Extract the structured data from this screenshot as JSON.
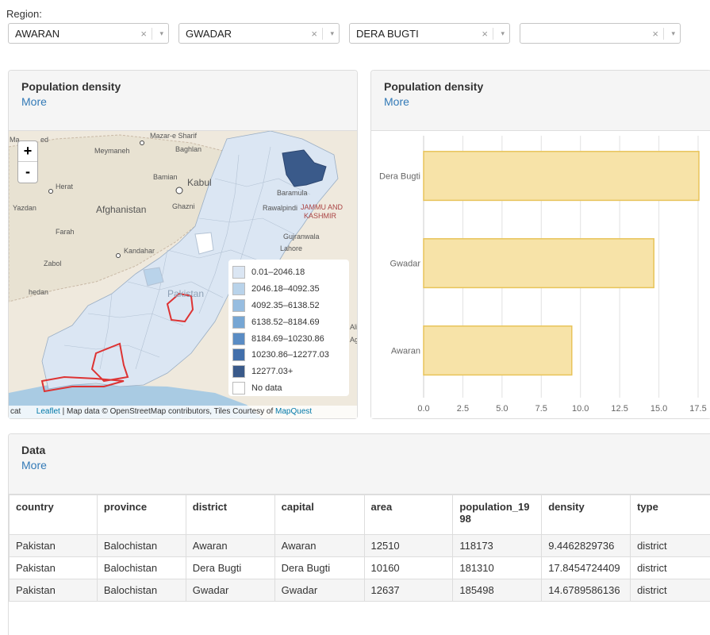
{
  "region_label": "Region:",
  "selects": [
    {
      "value": "AWARAN",
      "clear": "×",
      "arrow": "▾"
    },
    {
      "value": "GWADAR",
      "clear": "×",
      "arrow": "▾"
    },
    {
      "value": "DERA BUGTI",
      "clear": "×",
      "arrow": "▾"
    },
    {
      "value": "",
      "clear": "×",
      "arrow": "▾"
    }
  ],
  "map_panel": {
    "title": "Population density",
    "more": "More"
  },
  "chart_panel": {
    "title": "Population density",
    "more": "More"
  },
  "data_panel": {
    "title": "Data",
    "more": "More"
  },
  "map": {
    "zoom_in": "+",
    "zoom_out": "-",
    "places": {
      "mazar": "Mazar-e Sharif",
      "meymaneh": "Meymaneh",
      "baghlan": "Baghlan",
      "kabul": "Kabul",
      "bamian": "Bamian",
      "herat": "Herat",
      "afghanistan": "Afghanistan",
      "ghazni": "Ghazni",
      "farah": "Farah",
      "kandahar": "Kandahar",
      "zabol": "Zabol",
      "yazdan": "Yazdan",
      "baramula": "Baramula",
      "jammu": "JAMMU AND",
      "kashmir": "KASHMIR",
      "lahore": "Lahore",
      "gujranwala": "Gujranwala",
      "pakistan": "Pakistan",
      "rawalpindi": "Rawalpindi",
      "ma": "Ma",
      "ed": "ed",
      "hedan": "hedan",
      "ali": "Ali",
      "ag": "Ag",
      "cat": "cat"
    },
    "legend": [
      {
        "label": "0.01–2046.18",
        "color": "#dbe6f3"
      },
      {
        "label": "2046.18–4092.35",
        "color": "#b9d3ea"
      },
      {
        "label": "4092.35–6138.52",
        "color": "#97bde0"
      },
      {
        "label": "6138.52–8184.69",
        "color": "#76a6d4"
      },
      {
        "label": "8184.69–10230.86",
        "color": "#5a8cc4"
      },
      {
        "label": "10230.86–12277.03",
        "color": "#426fab"
      },
      {
        "label": "12277.03+",
        "color": "#3a5a8a"
      },
      {
        "label": "No data",
        "color": "#ffffff"
      }
    ],
    "attribution_prefix": "cat",
    "attribution_leaflet": "Leaflet",
    "attribution_text": " | Map data © OpenStreetMap contributors, Tiles Courtesy of ",
    "attribution_mapquest": "MapQuest"
  },
  "chart_data": {
    "type": "bar",
    "orientation": "horizontal",
    "categories": [
      "Dera Bugti",
      "Gwadar",
      "Awaran"
    ],
    "values": [
      17.84547244,
      14.678958613,
      9.4462829736
    ],
    "xlim": [
      0,
      17.5
    ],
    "xticks": [
      "0.0",
      "2.5",
      "5.0",
      "7.5",
      "10.0",
      "12.5",
      "15.0",
      "17.5"
    ],
    "bar_fill": "#f7e3a8",
    "bar_stroke": "#e8c45a",
    "grid": true
  },
  "table": {
    "headers": [
      "country",
      "province",
      "district",
      "capital",
      "area",
      "population_1998",
      "density",
      "type"
    ],
    "rows": [
      [
        "Pakistan",
        "Balochistan",
        "Awaran",
        "Awaran",
        "12510",
        "118173",
        "9.4462829736",
        "district"
      ],
      [
        "Pakistan",
        "Balochistan",
        "Dera Bugti",
        "Dera Bugti",
        "10160",
        "181310",
        "17.8454724409",
        "district"
      ],
      [
        "Pakistan",
        "Balochistan",
        "Gwadar",
        "Gwadar",
        "12637",
        "185498",
        "14.6789586136",
        "district"
      ]
    ]
  }
}
